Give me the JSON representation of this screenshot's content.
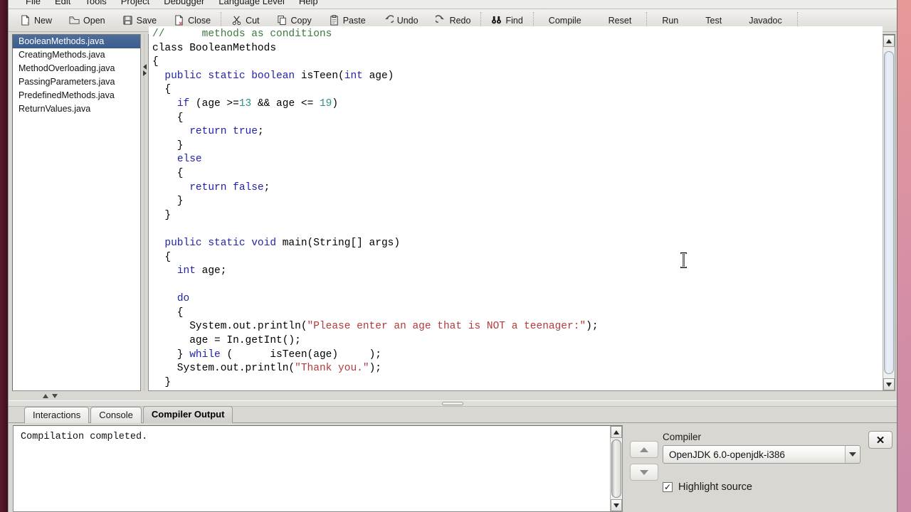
{
  "menubar": {
    "items": [
      {
        "label": "File"
      },
      {
        "label": "Edit"
      },
      {
        "label": "Tools"
      },
      {
        "label": "Project"
      },
      {
        "label": "Debugger"
      },
      {
        "label": "Language Level"
      },
      {
        "label": "Help"
      }
    ]
  },
  "toolbar": {
    "buttons": [
      {
        "label": "New",
        "icon": "new-file-icon"
      },
      {
        "label": "Open",
        "icon": "open-folder-icon"
      },
      {
        "label": "Save",
        "icon": "save-disk-icon"
      },
      {
        "label": "Close",
        "icon": "close-file-icon"
      },
      {
        "label": "Cut",
        "icon": "scissors-icon"
      },
      {
        "label": "Copy",
        "icon": "copy-pages-icon"
      },
      {
        "label": "Paste",
        "icon": "clipboard-icon"
      },
      {
        "label": "Undo",
        "icon": "undo-arrow-icon"
      },
      {
        "label": "Redo",
        "icon": "redo-arrow-icon"
      },
      {
        "label": "Find",
        "icon": "binoculars-icon"
      },
      {
        "label": "Compile",
        "icon": ""
      },
      {
        "label": "Reset",
        "icon": ""
      },
      {
        "label": "Run",
        "icon": ""
      },
      {
        "label": "Test",
        "icon": ""
      },
      {
        "label": "Javadoc",
        "icon": ""
      }
    ]
  },
  "file_list": {
    "items": [
      {
        "name": "BooleanMethods.java",
        "selected": true
      },
      {
        "name": "CreatingMethods.java",
        "selected": false
      },
      {
        "name": "MethodOverloading.java",
        "selected": false
      },
      {
        "name": "PassingParameters.java",
        "selected": false
      },
      {
        "name": "PredefinedMethods.java",
        "selected": false
      },
      {
        "name": "ReturnValues.java",
        "selected": false
      }
    ]
  },
  "editor": {
    "lines": [
      [
        {
          "t": "// ",
          "c": "cmt"
        },
        {
          "t": "     methods as conditions",
          "c": "cmt"
        }
      ],
      [
        {
          "t": "class BooleanMethods",
          "c": "pl"
        }
      ],
      [
        {
          "t": "{",
          "c": "pl"
        }
      ],
      [
        {
          "t": "  ",
          "c": "pl"
        },
        {
          "t": "public static boolean ",
          "c": "k"
        },
        {
          "t": "isTeen(",
          "c": "pl"
        },
        {
          "t": "int ",
          "c": "k"
        },
        {
          "t": "age)",
          "c": "pl"
        }
      ],
      [
        {
          "t": "  {",
          "c": "pl"
        }
      ],
      [
        {
          "t": "    ",
          "c": "pl"
        },
        {
          "t": "if ",
          "c": "k"
        },
        {
          "t": "(age >=",
          "c": "pl"
        },
        {
          "t": "13",
          "c": "num"
        },
        {
          "t": " && age <= ",
          "c": "pl"
        },
        {
          "t": "19",
          "c": "num"
        },
        {
          "t": ")",
          "c": "pl"
        }
      ],
      [
        {
          "t": "    {",
          "c": "pl"
        }
      ],
      [
        {
          "t": "      ",
          "c": "pl"
        },
        {
          "t": "return true",
          "c": "k"
        },
        {
          "t": ";",
          "c": "pl"
        }
      ],
      [
        {
          "t": "    }",
          "c": "pl"
        }
      ],
      [
        {
          "t": "    ",
          "c": "pl"
        },
        {
          "t": "else",
          "c": "k"
        }
      ],
      [
        {
          "t": "    {",
          "c": "pl"
        }
      ],
      [
        {
          "t": "      ",
          "c": "pl"
        },
        {
          "t": "return false",
          "c": "k"
        },
        {
          "t": ";",
          "c": "pl"
        }
      ],
      [
        {
          "t": "    }",
          "c": "pl"
        }
      ],
      [
        {
          "t": "  }",
          "c": "pl"
        }
      ],
      [
        {
          "t": "",
          "c": "pl"
        }
      ],
      [
        {
          "t": "  ",
          "c": "pl"
        },
        {
          "t": "public static void ",
          "c": "k"
        },
        {
          "t": "main(String[] args)",
          "c": "pl"
        }
      ],
      [
        {
          "t": "  {",
          "c": "pl"
        }
      ],
      [
        {
          "t": "    ",
          "c": "pl"
        },
        {
          "t": "int ",
          "c": "k"
        },
        {
          "t": "age;",
          "c": "pl"
        }
      ],
      [
        {
          "t": "",
          "c": "pl"
        }
      ],
      [
        {
          "t": "    ",
          "c": "pl"
        },
        {
          "t": "do",
          "c": "k"
        }
      ],
      [
        {
          "t": "    {",
          "c": "pl"
        }
      ],
      [
        {
          "t": "      System.out.println(",
          "c": "pl"
        },
        {
          "t": "\"Please enter an age that is NOT a teenager:\"",
          "c": "str"
        },
        {
          "t": ");",
          "c": "pl"
        }
      ],
      [
        {
          "t": "      age = In.getInt();",
          "c": "pl"
        }
      ],
      [
        {
          "t": "    } ",
          "c": "pl"
        },
        {
          "t": "while ",
          "c": "k"
        },
        {
          "t": "(      isTeen(age)     );",
          "c": "pl"
        }
      ],
      [
        {
          "t": "    System.out.println(",
          "c": "pl"
        },
        {
          "t": "\"Thank you.\"",
          "c": "str"
        },
        {
          "t": ");",
          "c": "pl"
        }
      ],
      [
        {
          "t": "  }",
          "c": "pl"
        }
      ],
      [
        {
          "t": "}",
          "c": "pl"
        }
      ]
    ]
  },
  "bottom_tabs": {
    "tabs": [
      {
        "label": "Interactions",
        "active": false
      },
      {
        "label": "Console",
        "active": false
      },
      {
        "label": "Compiler Output",
        "active": true
      }
    ]
  },
  "compiler_output": {
    "text": "Compilation completed."
  },
  "compiler_panel": {
    "label": "Compiler",
    "selected_compiler": "OpenJDK 6.0-openjdk-i386",
    "highlight_source_label": "Highlight source",
    "highlight_source_checked": true,
    "checkmark": "✓",
    "close_label": "✕"
  },
  "colors": {
    "selection_blue": "#3b5c8c",
    "keyword": "#2222aa",
    "string": "#b33a3a",
    "number": "#2f8f8f",
    "comment": "#3a7a3a",
    "desktop_left": "#4a1324",
    "chrome": "#d9d7d2"
  }
}
